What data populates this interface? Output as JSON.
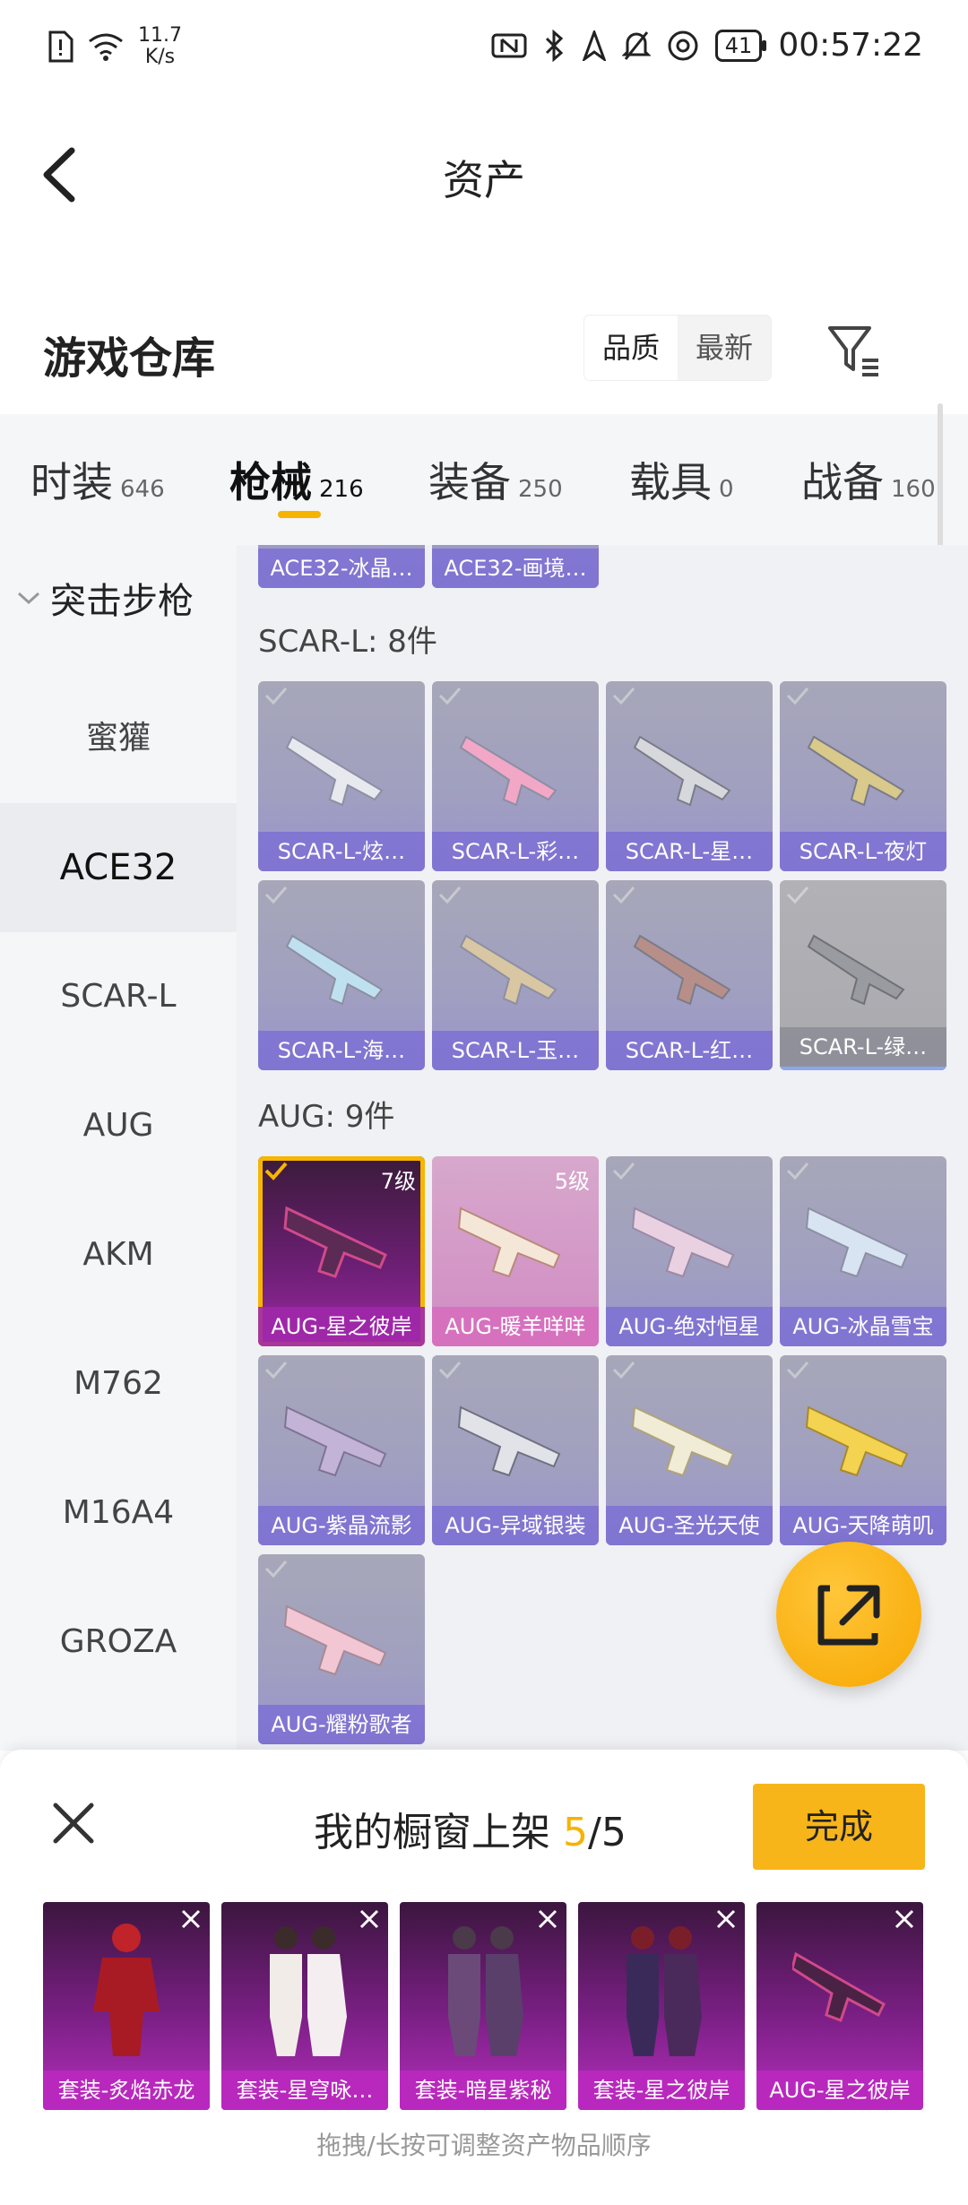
{
  "status_bar": {
    "net_speed_top": "11.7",
    "net_speed_bottom": "K/s",
    "battery": "41",
    "time": "00:57:22"
  },
  "header": {
    "title": "资产"
  },
  "warehouse": {
    "title": "游戏仓库",
    "sort_options": [
      "品质",
      "最新"
    ],
    "active_sort": "品质"
  },
  "tabs": [
    {
      "label": "时装",
      "count": "646"
    },
    {
      "label": "枪械",
      "count": "216",
      "active": true
    },
    {
      "label": "装备",
      "count": "250"
    },
    {
      "label": "载具",
      "count": "0"
    },
    {
      "label": "战备",
      "count": "160"
    }
  ],
  "sidebar": {
    "group": "突击步枪",
    "items": [
      "蜜獾",
      "ACE32",
      "SCAR-L",
      "AUG",
      "AKM",
      "M762",
      "M16A4",
      "GROZA"
    ],
    "active": "ACE32"
  },
  "grid": {
    "partial_top": [
      "ACE32-冰晶…",
      "ACE32-画境…"
    ],
    "sections": [
      {
        "title": "SCAR-L: 8件",
        "items": [
          "SCAR-L-炫…",
          "SCAR-L-彩…",
          "SCAR-L-星…",
          "SCAR-L-夜灯",
          "SCAR-L-海…",
          "SCAR-L-玉…",
          "SCAR-L-红…",
          "SCAR-L-绿…"
        ]
      },
      {
        "title": "AUG: 9件",
        "items": [
          "AUG-星之彼岸",
          "AUG-暖羊咩咩",
          "AUG-绝对恒星",
          "AUG-冰晶雪宝",
          "AUG-紫晶流影",
          "AUG-异域银装",
          "AUG-圣光天使",
          "AUG-天降萌叽",
          "AUG-耀粉歌者"
        ],
        "levels": [
          "7级",
          "5级"
        ]
      }
    ]
  },
  "showcase": {
    "title_prefix": "我的橱窗上架 ",
    "count": "5",
    "total": "/5",
    "done_label": "完成",
    "items": [
      "套装-炙焰赤龙",
      "套装-星穹咏…",
      "套装-暗星紫秘",
      "套装-星之彼岸",
      "AUG-星之彼岸"
    ],
    "hint": "拖拽/长按可调整资产物品顺序"
  },
  "colors": {
    "accent": "#f6b300",
    "card_purple": "#7d70d2",
    "selected_magenta": "#b52fbd"
  }
}
